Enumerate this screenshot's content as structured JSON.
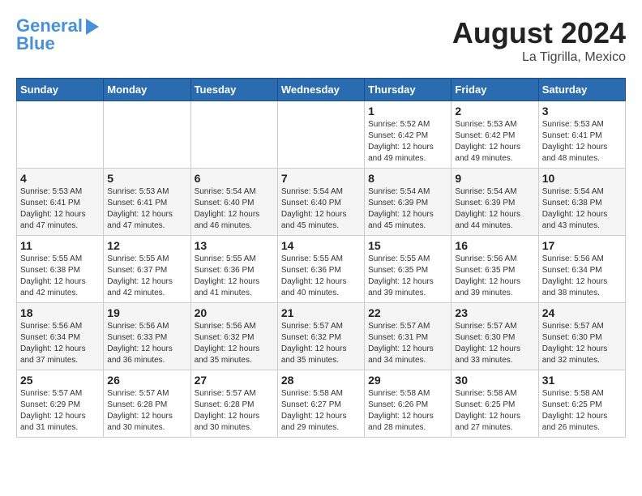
{
  "header": {
    "logo_line1": "General",
    "logo_line2": "Blue",
    "month_year": "August 2024",
    "location": "La Tigrilla, Mexico"
  },
  "days_of_week": [
    "Sunday",
    "Monday",
    "Tuesday",
    "Wednesday",
    "Thursday",
    "Friday",
    "Saturday"
  ],
  "weeks": [
    [
      {
        "day": "",
        "info": ""
      },
      {
        "day": "",
        "info": ""
      },
      {
        "day": "",
        "info": ""
      },
      {
        "day": "",
        "info": ""
      },
      {
        "day": "1",
        "info": "Sunrise: 5:52 AM\nSunset: 6:42 PM\nDaylight: 12 hours\nand 49 minutes."
      },
      {
        "day": "2",
        "info": "Sunrise: 5:53 AM\nSunset: 6:42 PM\nDaylight: 12 hours\nand 49 minutes."
      },
      {
        "day": "3",
        "info": "Sunrise: 5:53 AM\nSunset: 6:41 PM\nDaylight: 12 hours\nand 48 minutes."
      }
    ],
    [
      {
        "day": "4",
        "info": "Sunrise: 5:53 AM\nSunset: 6:41 PM\nDaylight: 12 hours\nand 47 minutes."
      },
      {
        "day": "5",
        "info": "Sunrise: 5:53 AM\nSunset: 6:41 PM\nDaylight: 12 hours\nand 47 minutes."
      },
      {
        "day": "6",
        "info": "Sunrise: 5:54 AM\nSunset: 6:40 PM\nDaylight: 12 hours\nand 46 minutes."
      },
      {
        "day": "7",
        "info": "Sunrise: 5:54 AM\nSunset: 6:40 PM\nDaylight: 12 hours\nand 45 minutes."
      },
      {
        "day": "8",
        "info": "Sunrise: 5:54 AM\nSunset: 6:39 PM\nDaylight: 12 hours\nand 45 minutes."
      },
      {
        "day": "9",
        "info": "Sunrise: 5:54 AM\nSunset: 6:39 PM\nDaylight: 12 hours\nand 44 minutes."
      },
      {
        "day": "10",
        "info": "Sunrise: 5:54 AM\nSunset: 6:38 PM\nDaylight: 12 hours\nand 43 minutes."
      }
    ],
    [
      {
        "day": "11",
        "info": "Sunrise: 5:55 AM\nSunset: 6:38 PM\nDaylight: 12 hours\nand 42 minutes."
      },
      {
        "day": "12",
        "info": "Sunrise: 5:55 AM\nSunset: 6:37 PM\nDaylight: 12 hours\nand 42 minutes."
      },
      {
        "day": "13",
        "info": "Sunrise: 5:55 AM\nSunset: 6:36 PM\nDaylight: 12 hours\nand 41 minutes."
      },
      {
        "day": "14",
        "info": "Sunrise: 5:55 AM\nSunset: 6:36 PM\nDaylight: 12 hours\nand 40 minutes."
      },
      {
        "day": "15",
        "info": "Sunrise: 5:55 AM\nSunset: 6:35 PM\nDaylight: 12 hours\nand 39 minutes."
      },
      {
        "day": "16",
        "info": "Sunrise: 5:56 AM\nSunset: 6:35 PM\nDaylight: 12 hours\nand 39 minutes."
      },
      {
        "day": "17",
        "info": "Sunrise: 5:56 AM\nSunset: 6:34 PM\nDaylight: 12 hours\nand 38 minutes."
      }
    ],
    [
      {
        "day": "18",
        "info": "Sunrise: 5:56 AM\nSunset: 6:34 PM\nDaylight: 12 hours\nand 37 minutes."
      },
      {
        "day": "19",
        "info": "Sunrise: 5:56 AM\nSunset: 6:33 PM\nDaylight: 12 hours\nand 36 minutes."
      },
      {
        "day": "20",
        "info": "Sunrise: 5:56 AM\nSunset: 6:32 PM\nDaylight: 12 hours\nand 35 minutes."
      },
      {
        "day": "21",
        "info": "Sunrise: 5:57 AM\nSunset: 6:32 PM\nDaylight: 12 hours\nand 35 minutes."
      },
      {
        "day": "22",
        "info": "Sunrise: 5:57 AM\nSunset: 6:31 PM\nDaylight: 12 hours\nand 34 minutes."
      },
      {
        "day": "23",
        "info": "Sunrise: 5:57 AM\nSunset: 6:30 PM\nDaylight: 12 hours\nand 33 minutes."
      },
      {
        "day": "24",
        "info": "Sunrise: 5:57 AM\nSunset: 6:30 PM\nDaylight: 12 hours\nand 32 minutes."
      }
    ],
    [
      {
        "day": "25",
        "info": "Sunrise: 5:57 AM\nSunset: 6:29 PM\nDaylight: 12 hours\nand 31 minutes."
      },
      {
        "day": "26",
        "info": "Sunrise: 5:57 AM\nSunset: 6:28 PM\nDaylight: 12 hours\nand 30 minutes."
      },
      {
        "day": "27",
        "info": "Sunrise: 5:57 AM\nSunset: 6:28 PM\nDaylight: 12 hours\nand 30 minutes."
      },
      {
        "day": "28",
        "info": "Sunrise: 5:58 AM\nSunset: 6:27 PM\nDaylight: 12 hours\nand 29 minutes."
      },
      {
        "day": "29",
        "info": "Sunrise: 5:58 AM\nSunset: 6:26 PM\nDaylight: 12 hours\nand 28 minutes."
      },
      {
        "day": "30",
        "info": "Sunrise: 5:58 AM\nSunset: 6:25 PM\nDaylight: 12 hours\nand 27 minutes."
      },
      {
        "day": "31",
        "info": "Sunrise: 5:58 AM\nSunset: 6:25 PM\nDaylight: 12 hours\nand 26 minutes."
      }
    ]
  ]
}
